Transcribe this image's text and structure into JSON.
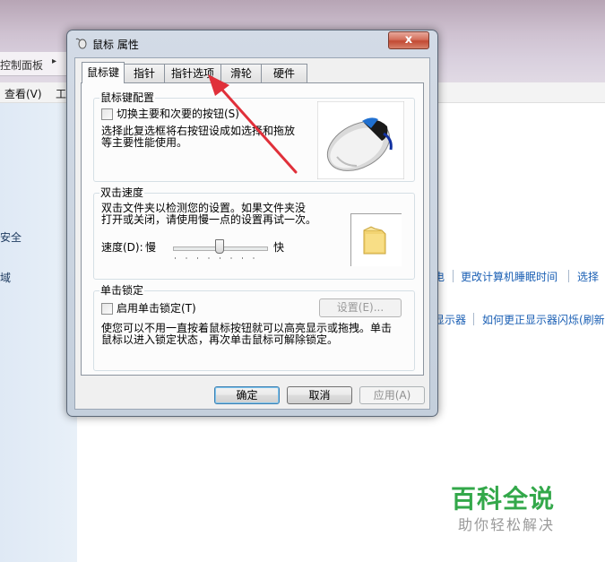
{
  "background": {
    "breadcrumb": "控制面板",
    "breadcrumb_arrow": "▸",
    "menu": [
      "查看(V)",
      "工"
    ],
    "left_items": [
      "安全",
      "域"
    ],
    "links_row1": [
      "电",
      "更改计算机睡眠时间",
      "选择"
    ],
    "links_row2": [
      "显示器",
      "如何更正显示器闪烁(刷新"
    ]
  },
  "dialog": {
    "title": "鼠标 属性",
    "close_glyph": "x",
    "tabs": [
      "鼠标键",
      "指针",
      "指针选项",
      "滑轮",
      "硬件"
    ],
    "active_tab": "鼠标键",
    "button_config": {
      "label": "鼠标键配置",
      "checkbox_label": "切换主要和次要的按钮(S)",
      "checked": false,
      "description_lines": [
        "选择此复选框将右按钮设成如选择和拖放",
        "等主要性能使用。"
      ]
    },
    "double_click": {
      "label": "双击速度",
      "description_lines": [
        "双击文件夹以检测您的设置。如果文件夹没",
        "打开或关闭，请使用慢一点的设置再试一次。"
      ],
      "speed_label": "速度(D):",
      "slow_label": "慢",
      "fast_label": "快",
      "slider_value_fraction": 0.5
    },
    "click_lock": {
      "label": "单击锁定",
      "checkbox_label": "启用单击锁定(T)",
      "checked": false,
      "settings_button": "设置(E)...",
      "description_lines": [
        "使您可以不用一直按着鼠标按钮就可以高亮显示或拖拽。单击",
        "鼠标以进入锁定状态，再次单击鼠标可解除锁定。"
      ]
    },
    "buttons": {
      "ok": "确定",
      "cancel": "取消",
      "apply": "应用(A)"
    }
  },
  "watermark": {
    "title": "百科全说",
    "subtitle": "助你轻松解决"
  },
  "colors": {
    "link": "#1a5fb4",
    "annotation_arrow": "#e0303a",
    "watermark": "#33a84a"
  }
}
